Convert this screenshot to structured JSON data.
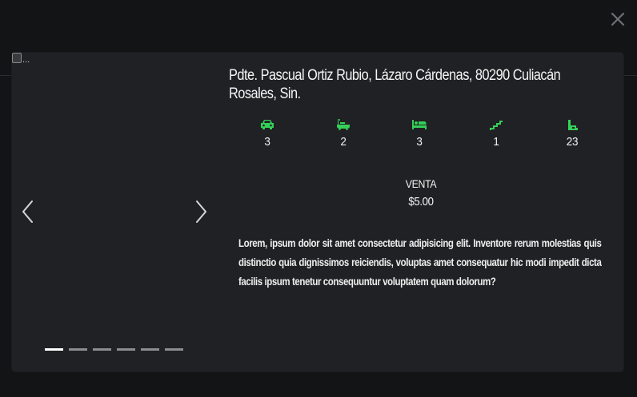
{
  "modal": {
    "close_icon": "close-icon",
    "image": {
      "alt_text": "..."
    },
    "carousel": {
      "prev_icon": "chevron-left-icon",
      "next_icon": "chevron-right-icon",
      "slide_count": 6,
      "active_index": 0
    },
    "property": {
      "address": "Pdte. Pascual Ortiz Rubio, Lázaro Cárdenas, 80290 Culiacán Rosales, Sin.",
      "features": [
        {
          "icon": "car-icon",
          "value": "3"
        },
        {
          "icon": "bathtub-icon",
          "value": "2"
        },
        {
          "icon": "bed-icon",
          "value": "3"
        },
        {
          "icon": "stairs-icon",
          "value": "1"
        },
        {
          "icon": "area-icon",
          "value": "23"
        }
      ],
      "deal_type": "VENTA",
      "price": "$5.00",
      "description": "Lorem, ipsum dolor sit amet consectetur adipisicing elit. Inventore rerum molestias quis distinctio quia dignissimos reiciendis, voluptas amet consequatur hic modi impedit dicta facilis ipsum tenetur consequuntur voluptatem quam dolorum?"
    },
    "colors": {
      "accent": "#34d058",
      "background": "#131416",
      "panel": "#202124",
      "text": "#ffffff",
      "indicator_inactive": "#8c8d90",
      "indicator_active": "#ffffff"
    }
  }
}
